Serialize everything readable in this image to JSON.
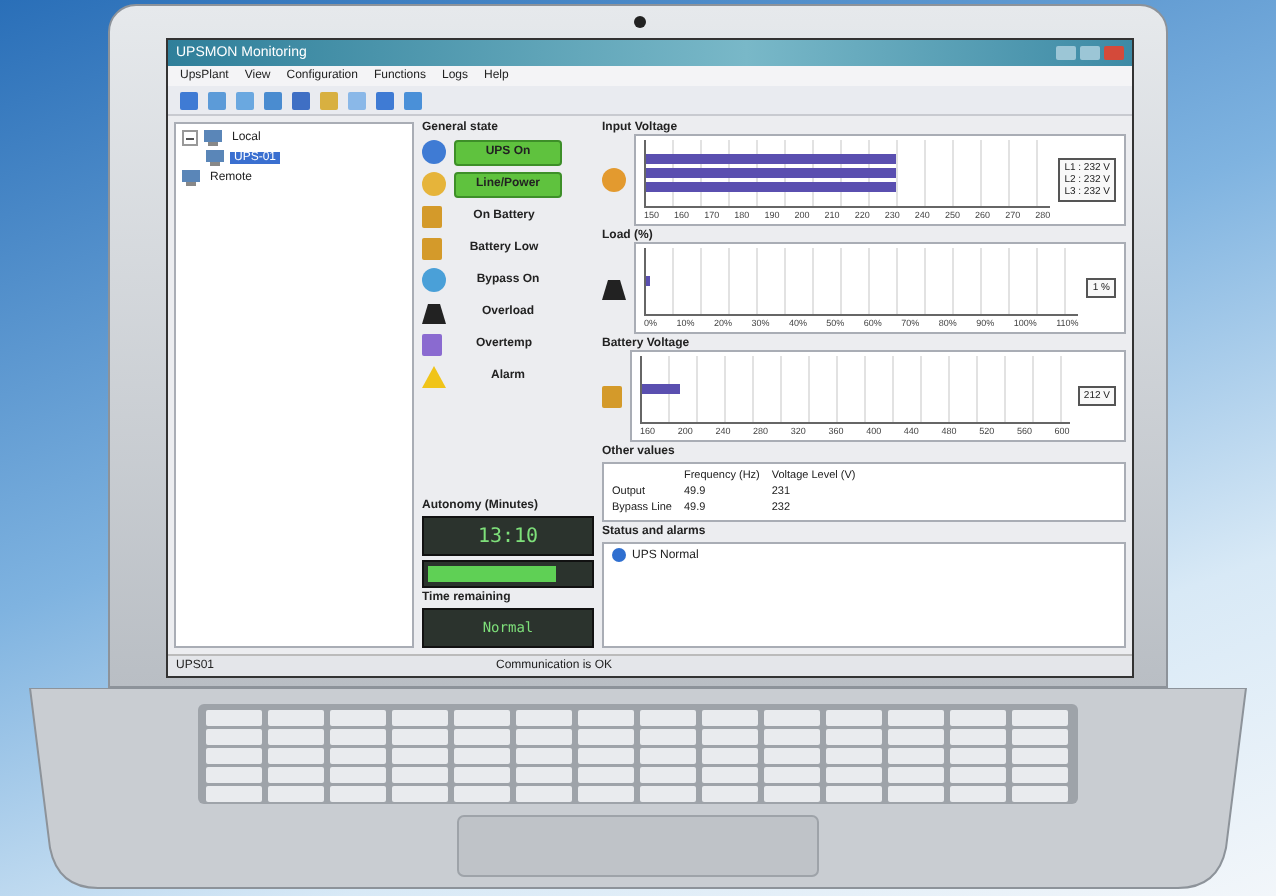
{
  "window": {
    "title": "UPSMON Monitoring"
  },
  "menu": [
    "UpsPlant",
    "View",
    "Configuration",
    "Functions",
    "Logs",
    "Help"
  ],
  "tree": [
    {
      "label": "Local",
      "expanded": true,
      "selected": false,
      "children": [
        {
          "label": "UPS-01",
          "selected": true
        }
      ]
    },
    {
      "label": "Remote",
      "selected": false
    }
  ],
  "general_state": {
    "title": "General state",
    "items": [
      {
        "label": "UPS On",
        "on": true,
        "kind": "power"
      },
      {
        "label": "Line/Power",
        "on": true,
        "kind": "line"
      },
      {
        "label": "On Battery",
        "on": false,
        "kind": "battery"
      },
      {
        "label": "Battery Low",
        "on": false,
        "kind": "battery"
      },
      {
        "label": "Bypass On",
        "on": false,
        "kind": "bypass"
      },
      {
        "label": "Overload",
        "on": false,
        "kind": "load"
      },
      {
        "label": "Overtemp",
        "on": false,
        "kind": "temp"
      },
      {
        "label": "Alarm",
        "on": false,
        "kind": "alarm"
      }
    ]
  },
  "autonomy": {
    "title": "Autonomy (Minutes)",
    "value": "13:10",
    "level": 0.8
  },
  "time_remaining": {
    "title": "Time remaining",
    "value": "Normal"
  },
  "gauges": [
    {
      "title": "Input Voltage",
      "kind": "plug",
      "bars": [
        {
          "level": 0.62
        },
        {
          "level": 0.62
        },
        {
          "level": 0.62
        }
      ],
      "readings": [
        "L1 : 232 V",
        "L2 : 232 V",
        "L3 : 232 V"
      ],
      "ticks": [
        "150",
        "160",
        "170",
        "180",
        "190",
        "200",
        "210",
        "220",
        "230",
        "240",
        "250",
        "260",
        "270",
        "280"
      ]
    },
    {
      "title": "Load (%)",
      "kind": "load",
      "bars": [
        {
          "level": 0.01
        }
      ],
      "readings": [
        "1 %"
      ],
      "ticks": [
        "0%",
        "10%",
        "20%",
        "30%",
        "40%",
        "50%",
        "60%",
        "70%",
        "80%",
        "90%",
        "100%",
        "110%"
      ]
    },
    {
      "title": "Battery Voltage",
      "kind": "battery",
      "bars": [
        {
          "level": 0.09
        }
      ],
      "readings": [
        "212 V"
      ],
      "ticks": [
        "160",
        "200",
        "240",
        "280",
        "320",
        "360",
        "400",
        "440",
        "480",
        "520",
        "560",
        "600"
      ]
    }
  ],
  "other_values": {
    "title": "Other values",
    "columns": [
      "",
      "Frequency (Hz)",
      "Voltage Level (V)"
    ],
    "rows": [
      [
        "Output",
        "49.9",
        "231"
      ],
      [
        "Bypass Line",
        "49.9",
        "232"
      ]
    ]
  },
  "status_alarms": {
    "title": "Status and alarms",
    "items": [
      "UPS Normal"
    ]
  },
  "status_bar": [
    "UPS01",
    "Communication is OK"
  ]
}
